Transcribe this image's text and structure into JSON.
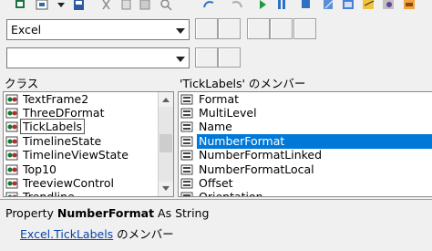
{
  "toolbar": {
    "icons": [
      "excel-icon",
      "view-toggle-icon",
      "dropdown-arrow-icon",
      "save-icon",
      "cut-icon",
      "copy-icon",
      "paste-icon",
      "find-icon",
      "undo-icon",
      "redo-icon",
      "run-icon",
      "break-icon",
      "reset-icon",
      "design-mode-icon",
      "project-explorer-icon",
      "properties-icon",
      "object-browser-icon",
      "toolbox-icon"
    ]
  },
  "library_combo": {
    "value": "Excel"
  },
  "search_combo": {
    "value": ""
  },
  "classes_pane": {
    "header": "クラス",
    "items": [
      {
        "label": "TextFrame2"
      },
      {
        "label": "ThreeDFormat"
      },
      {
        "label": "TickLabels"
      },
      {
        "label": "TimelineState"
      },
      {
        "label": "TimelineViewState"
      },
      {
        "label": "Top10"
      },
      {
        "label": "TreeviewControl"
      },
      {
        "label": "Trendline"
      }
    ],
    "selected": "TickLabels"
  },
  "members_pane": {
    "header": "'TickLabels' のメンバー",
    "items": [
      {
        "label": "Format"
      },
      {
        "label": "MultiLevel"
      },
      {
        "label": "Name"
      },
      {
        "label": "NumberFormat"
      },
      {
        "label": "NumberFormatLinked"
      },
      {
        "label": "NumberFormatLocal"
      },
      {
        "label": "Offset"
      },
      {
        "label": "Orientation"
      }
    ],
    "selected": "NumberFormat"
  },
  "detail": {
    "line1_prefix": "Property ",
    "line1_name": "NumberFormat",
    "line1_suffix": " As String",
    "line2_link1": "Excel",
    "line2_sep": ".",
    "line2_link2": "TickLabels",
    "line2_suffix": " のメンバー"
  },
  "colors": {
    "selection": "#0078d7",
    "link": "#0645ad"
  }
}
